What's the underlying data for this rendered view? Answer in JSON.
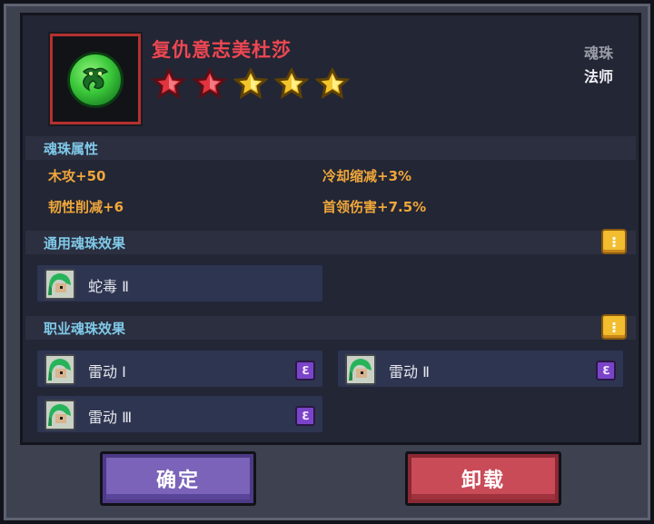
{
  "item": {
    "name": "复仇意志美杜莎",
    "type": "魂珠",
    "class": "法师",
    "stars": {
      "filled": 5,
      "red": 2,
      "gold": 3
    }
  },
  "sections": {
    "attributes": {
      "title": "魂珠属性",
      "items": [
        "木攻+50",
        "冷却缩减+3%",
        "韧性削减+6",
        "首领伤害+7.5%"
      ]
    },
    "general": {
      "title": "通用魂珠效果",
      "info_glyph": "⁝",
      "effects": [
        {
          "name": "蛇毒 Ⅱ"
        }
      ]
    },
    "class": {
      "title": "职业魂珠效果",
      "info_glyph": "⁝",
      "effects": [
        {
          "name": "雷动 Ⅰ",
          "badge": "ℇ"
        },
        {
          "name": "雷动 Ⅱ",
          "badge": "ℇ"
        },
        {
          "name": "雷动 Ⅲ",
          "badge": "ℇ"
        }
      ]
    }
  },
  "buttons": {
    "confirm": "确定",
    "unload": "卸载"
  },
  "colors": {
    "title": "#ee4752",
    "section": "#7fc9e8",
    "attribute": "#f0a73a",
    "star_red": "#e2343f",
    "star_gold": "#f4c52a",
    "confirm_button": "#7a63b8",
    "unload_button": "#c94b58"
  },
  "icons": {
    "item": "medusa-orb-icon",
    "info": "info-icon",
    "effect_portrait": "medusa-portrait-icon",
    "class_badge": "mage-class-icon"
  }
}
